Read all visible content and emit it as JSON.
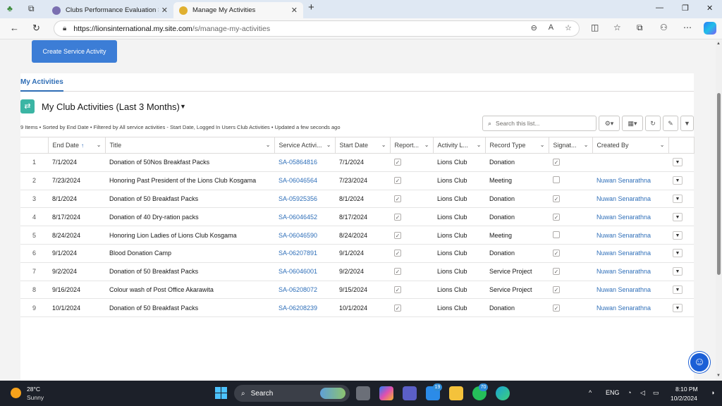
{
  "browser": {
    "tabs": [
      {
        "title": "Clubs Performance Evaluation Sys",
        "active": false
      },
      {
        "title": "Manage My Activities",
        "active": true
      }
    ],
    "url_host": "https://lionsinternational.my.site.com",
    "url_path": "/s/manage-my-activities"
  },
  "page": {
    "create_button": "Create Service Activity",
    "tab_label": "My Activities",
    "list_title": "My Club Activities (Last 3 Months)",
    "meta": "9 Items • Sorted by End Date • Filtered by All service activities - Start Date, Logged In Users Club Activities • Updated a few seconds ago",
    "search_placeholder": "Search this list...",
    "columns": [
      "End Date",
      "Title",
      "Service Activi...",
      "Start Date",
      "Report...",
      "Activity L...",
      "Record Type",
      "Signat...",
      "Created By"
    ],
    "rows": [
      {
        "n": "1",
        "end": "7/1/2024",
        "title": "Donation of 50Nos Breakfast Packs",
        "sa": "SA-05864816",
        "start": "7/1/2024",
        "report": true,
        "level": "Lions Club",
        "type": "Donation",
        "sig": true,
        "by": ""
      },
      {
        "n": "2",
        "end": "7/23/2024",
        "title": "Honoring Past President of the Lions Club Kosgama",
        "sa": "SA-06046564",
        "start": "7/23/2024",
        "report": true,
        "level": "Lions Club",
        "type": "Meeting",
        "sig": false,
        "by": "Nuwan Senarathna"
      },
      {
        "n": "3",
        "end": "8/1/2024",
        "title": "Donation of 50 Breakfast Packs",
        "sa": "SA-05925356",
        "start": "8/1/2024",
        "report": true,
        "level": "Lions Club",
        "type": "Donation",
        "sig": true,
        "by": "Nuwan Senarathna"
      },
      {
        "n": "4",
        "end": "8/17/2024",
        "title": "Donation of 40 Dry-ration packs",
        "sa": "SA-06046452",
        "start": "8/17/2024",
        "report": true,
        "level": "Lions Club",
        "type": "Donation",
        "sig": true,
        "by": "Nuwan Senarathna"
      },
      {
        "n": "5",
        "end": "8/24/2024",
        "title": "Honoring Lion Ladies of Lions Club Kosgama",
        "sa": "SA-06046590",
        "start": "8/24/2024",
        "report": true,
        "level": "Lions Club",
        "type": "Meeting",
        "sig": false,
        "by": "Nuwan Senarathna"
      },
      {
        "n": "6",
        "end": "9/1/2024",
        "title": "Blood Donation Camp",
        "sa": "SA-06207891",
        "start": "9/1/2024",
        "report": true,
        "level": "Lions Club",
        "type": "Donation",
        "sig": true,
        "by": "Nuwan Senarathna"
      },
      {
        "n": "7",
        "end": "9/2/2024",
        "title": "Donation of 50 Breakfast Packs",
        "sa": "SA-06046001",
        "start": "9/2/2024",
        "report": true,
        "level": "Lions Club",
        "type": "Service Project",
        "sig": true,
        "by": "Nuwan Senarathna"
      },
      {
        "n": "8",
        "end": "9/16/2024",
        "title": "Colour wash of Post Office Akarawita",
        "sa": "SA-06208072",
        "start": "9/15/2024",
        "report": true,
        "level": "Lions Club",
        "type": "Service Project",
        "sig": true,
        "by": "Nuwan Senarathna"
      },
      {
        "n": "9",
        "end": "10/1/2024",
        "title": "Donation of 50 Breakfast Packs",
        "sa": "SA-06208239",
        "start": "10/1/2024",
        "report": true,
        "level": "Lions Club",
        "type": "Donation",
        "sig": true,
        "by": "Nuwan Senarathna"
      }
    ]
  },
  "taskbar": {
    "temperature": "28°C",
    "condition": "Sunny",
    "search_label": "Search",
    "teams_badge": "19",
    "whatsapp_badge": "70",
    "language": "ENG",
    "time": "8:10 PM",
    "date": "10/2/2024"
  },
  "colors": {
    "accent": "#3c7dd6",
    "link": "#2f6fb9",
    "taskbar": "#1c2029"
  }
}
